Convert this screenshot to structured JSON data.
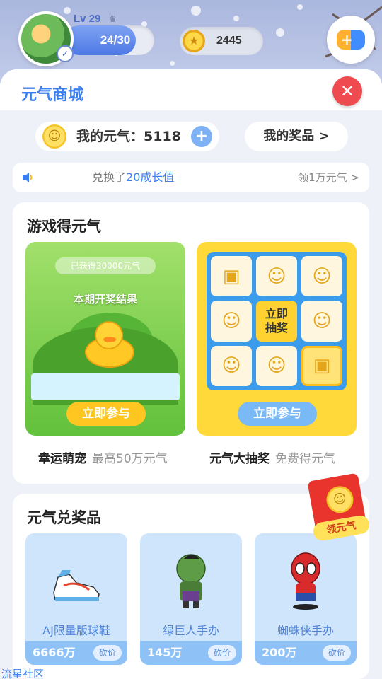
{
  "header": {
    "level": "Lv 29",
    "xp_text": "24/30",
    "xp_fraction": 0.8,
    "coins": "2445"
  },
  "sheet": {
    "title": "元气商城",
    "energy_label": "我的元气：5118",
    "plus": "+",
    "my_prizes": "我的奖品 >"
  },
  "notice": {
    "prefix": "兑换了",
    "highlight": "20成长值",
    "link": "领1万元气 >"
  },
  "games": {
    "title": "游戏得元气",
    "pet": {
      "banner": "已获得30000元气",
      "result_label": "本期开奖结果",
      "button": "立即参与",
      "name": "幸运萌宠",
      "sub": "最高50万元气"
    },
    "draw": {
      "center_label": "立即抽奖",
      "button": "立即参与",
      "name": "元气大抽奖",
      "sub": "免费得元气"
    }
  },
  "prizes": {
    "title": "元气兑奖品",
    "items": [
      {
        "name": "AJ限量版球鞋",
        "price": "6666万",
        "action": "砍价"
      },
      {
        "name": "绿巨人手办",
        "price": "145万",
        "action": "砍价"
      },
      {
        "name": "蜘蛛侠手办",
        "price": "200万",
        "action": "砍价"
      }
    ]
  },
  "redpack": {
    "label": "领元气"
  },
  "watermark": "流星社区",
  "colors": {
    "accent": "#3a7ff0",
    "close": "#ee4a4f",
    "prize_bg": "#cfe5fb",
    "redpack": "#e8342d"
  },
  "icons": [
    "gamepad-icon",
    "coin-icon",
    "smile-coin-icon",
    "speaker-icon",
    "close-icon",
    "plus-icon"
  ]
}
